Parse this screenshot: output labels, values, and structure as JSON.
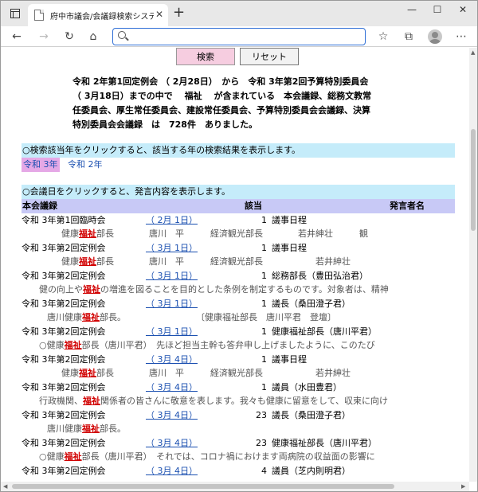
{
  "browser": {
    "tab_title": "府中市議会/会議録検索システム",
    "icons": [
      "window-menu-icon",
      "page-icon",
      "close-icon",
      "new-tab-icon",
      "minimize-icon",
      "maximize-icon",
      "window-close-icon",
      "back-icon",
      "forward-icon",
      "reload-icon",
      "home-icon",
      "search-icon",
      "favorite-icon",
      "collections-icon",
      "profile-icon",
      "more-icon"
    ],
    "symbols": {
      "tab_close": "✕",
      "new_tab": "+",
      "minimize": "—",
      "maximize": "☐",
      "close": "✕",
      "back": "←",
      "forward": "→",
      "reload": "↻",
      "home": "⌂",
      "favorite": "☆",
      "collections": "⧉",
      "more": "⋯"
    }
  },
  "buttons": {
    "search": "検索",
    "reset": "リセット"
  },
  "summary": {
    "lines": [
      "令和 2年第1回定例会 （ 2月28日）　から　令和 3年第2回予算特別委員会",
      "（ 3月18日）までの中で　 福祉　 が含まれている　本会議録、総務文教常",
      "任委員会、厚生常任委員会、建設常任委員会、予算特別委員会会議録、決算",
      "特別委員会会議録　は　728件　ありました。"
    ]
  },
  "year_bar": "○検索該当年をクリックすると、該当する年の検索結果を表示します。",
  "years": [
    "令和 3年",
    "令和 2年"
  ],
  "date_bar": "○会議日をクリックすると、発言内容を表示します。",
  "header": {
    "col1": "本会議録",
    "col2": "該当",
    "col3": "発言者名"
  },
  "keyword": "福祉",
  "rows": [
    {
      "meeting": "令和 3年第1回臨時会",
      "date": "（ 2月 1日）",
      "count": "1",
      "speaker": "議事日程",
      "snippet": {
        "pre": "健康",
        "post": "部長　　　　唐川　平　　　経済観光部長　　　　若井紳壮　　　観"
      }
    },
    {
      "meeting": "令和 3年第2回定例会",
      "date": "（ 3月 1日）",
      "count": "1",
      "speaker": "議事日程",
      "snippet": {
        "pre": "健康",
        "post": "部長　　　　唐川　平　　　経済観光部長　　　　　　若井紳壮"
      }
    },
    {
      "meeting": "令和 3年第2回定例会",
      "date": "（ 3月 1日）",
      "count": "1",
      "speaker": "総務部長（豊田弘治君）",
      "snippet": {
        "pre": "健の向上や",
        "post": "の増進を図ることを目的とした条例を制定するものです。対象者は、精神"
      }
    },
    {
      "meeting": "令和 3年第2回定例会",
      "date": "（ 3月 1日）",
      "count": "1",
      "speaker": "議長（桑田澄子君）",
      "snippet": {
        "pre": "唐川健康",
        "post": "部長。　　　　　　　　　〔健康福祉部長　唐川平君　登壇〕"
      }
    },
    {
      "meeting": "令和 3年第2回定例会",
      "date": "（ 3月 1日）",
      "count": "1",
      "speaker": "健康福祉部長（唐川平君）",
      "snippet": {
        "pre": "○健康",
        "post": "部長（唐川平君）　先ほど担当主幹も答弁申し上げましたように、このたび"
      }
    },
    {
      "meeting": "令和 3年第2回定例会",
      "date": "（ 3月 4日）",
      "count": "1",
      "speaker": "議事日程",
      "snippet": {
        "pre": "健康",
        "post": "部長　　　　唐川　平　　　経済観光部長　　　　　　若井紳壮"
      }
    },
    {
      "meeting": "令和 3年第2回定例会",
      "date": "（ 3月 4日）",
      "count": "1",
      "speaker": "議員（水田豊君）",
      "snippet": {
        "pre": "行政機関、",
        "post": "関係者の皆さんに敬意を表します。我々も健康に留意をして、収束に向け"
      }
    },
    {
      "meeting": "令和 3年第2回定例会",
      "date": "（ 3月 4日）",
      "count": "23",
      "speaker": "議長（桑田澄子君）",
      "snippet": {
        "pre": "唐川健康",
        "post": "部長。"
      }
    },
    {
      "meeting": "令和 3年第2回定例会",
      "date": "（ 3月 4日）",
      "count": "23",
      "speaker": "健康福祉部長（唐川平君）",
      "snippet": {
        "pre": "○健康",
        "post": "部長（唐川平君）　それでは、コロナ禍におけます両病院の収益面の影響に"
      }
    },
    {
      "meeting": "令和 3年第2回定例会",
      "date": "（ 3月 4日）",
      "count": "4",
      "speaker": "議員（芝内則明君）",
      "snippet": null
    }
  ]
}
